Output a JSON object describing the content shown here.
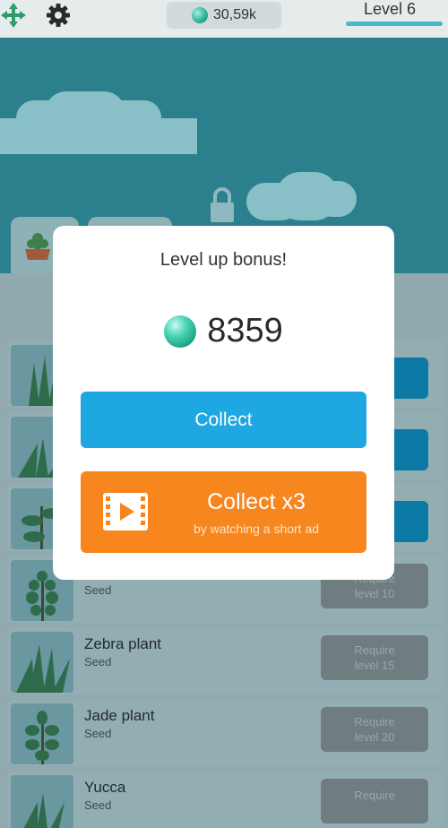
{
  "header": {
    "gems": "30,59k",
    "level": "Level 6"
  },
  "modal": {
    "title": "Level up bonus!",
    "amount": "8359",
    "collect_label": "Collect",
    "collect_x3_label": "Collect x3",
    "collect_x3_sub": "by watching a short ad"
  },
  "plants": [
    {
      "name": "",
      "sub": "Seed",
      "req_line1": "Require",
      "req_line2": "level 10"
    },
    {
      "name": "Zebra plant",
      "sub": "Seed",
      "req_line1": "Require",
      "req_line2": "level 15"
    },
    {
      "name": "Jade plant",
      "sub": "Seed",
      "req_line1": "Require",
      "req_line2": "level 20"
    },
    {
      "name": "Yucca",
      "sub": "Seed",
      "req_line1": "Require",
      "req_line2": ""
    }
  ],
  "colors": {
    "accent_blue": "#1ea7e1",
    "accent_orange": "#f7861e",
    "gem": "#2fb59d"
  },
  "icons": [
    "move-icon",
    "gear-icon",
    "gem-icon",
    "lock-icon",
    "pot-icon",
    "film-play-icon"
  ]
}
